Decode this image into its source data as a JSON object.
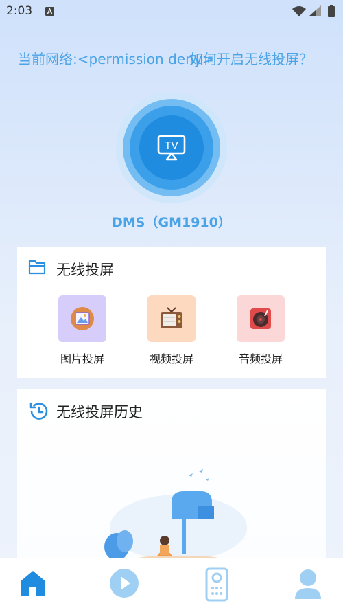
{
  "status_bar": {
    "time": "2:03"
  },
  "header": {
    "network_text": "当前网络:<permission deny>",
    "help_link": "如何开启无线投屏？"
  },
  "device": {
    "name": "DMS（GM1910）"
  },
  "cast_button": {
    "icon": "tv-airplay-icon",
    "label": "TV"
  },
  "wireless_card": {
    "title": "无线投屏",
    "items": [
      {
        "label": "图片投屏",
        "icon": "picture-icon",
        "color": "#d6cdfb"
      },
      {
        "label": "视频投屏",
        "icon": "retro-tv-icon",
        "color": "#fdd9bf"
      },
      {
        "label": "音频投屏",
        "icon": "record-player-icon",
        "color": "#fbd7d7"
      }
    ]
  },
  "history_card": {
    "title": "无线投屏历史"
  },
  "tab_bar": {
    "tabs": [
      {
        "icon": "home-icon",
        "active": true
      },
      {
        "icon": "play-icon",
        "active": false
      },
      {
        "icon": "remote-icon",
        "active": false
      },
      {
        "icon": "user-icon",
        "active": false
      }
    ]
  },
  "colors": {
    "accent": "#1f8ce0",
    "link": "#4aa3e6",
    "inactive": "#9fd0f3"
  }
}
